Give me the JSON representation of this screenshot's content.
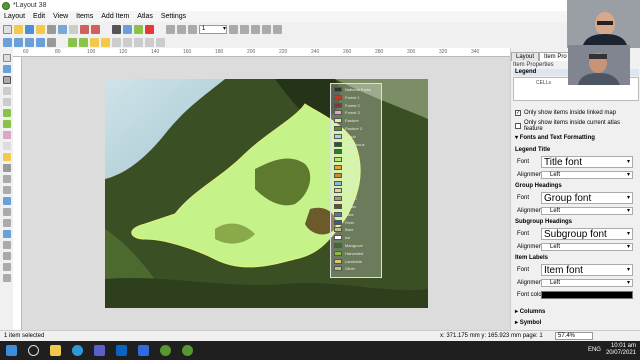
{
  "window": {
    "title": "*Layout 38"
  },
  "menu": [
    "Layout",
    "Edit",
    "View",
    "Items",
    "Add Item",
    "Atlas",
    "Settings"
  ],
  "toolbar": {
    "atlas_page": "1"
  },
  "ruler_ticks": [
    "60",
    "80",
    "100",
    "120",
    "140",
    "160",
    "180",
    "200",
    "220",
    "240",
    "260",
    "280",
    "300",
    "320",
    "340"
  ],
  "legend_entries": [
    {
      "label": "National Parks",
      "color": "#333333"
    },
    {
      "label": "Forest 1",
      "color": "#c0392b"
    },
    {
      "label": "Forest 2",
      "color": "#7b3b3b"
    },
    {
      "label": "Forest 3",
      "color": "#d9a7c7"
    },
    {
      "label": "Pasture",
      "color": "#e8e8a0"
    },
    {
      "label": "Pasture 2",
      "color": "#5a8a3a"
    },
    {
      "label": "Shrub",
      "color": "#a0d8e8"
    },
    {
      "label": "Indigenous",
      "color": "#1e5d2a"
    },
    {
      "label": "Exotic",
      "color": "#2e7d32"
    },
    {
      "label": "Grass",
      "color": "#c6e07a"
    },
    {
      "label": "Tussock",
      "color": "#e3a23a"
    },
    {
      "label": "Scrub",
      "color": "#c98b3b"
    },
    {
      "label": "Wetland",
      "color": "#8fb3d9"
    },
    {
      "label": "Sand",
      "color": "#e0d3a0"
    },
    {
      "label": "Gravel",
      "color": "#a0a080"
    },
    {
      "label": "Urban",
      "color": "#6b4e2e"
    },
    {
      "label": "Lake",
      "color": "#4a7aa8"
    },
    {
      "label": "River",
      "color": "#2e5e8a"
    },
    {
      "label": "Bare",
      "color": "#c9b88a"
    },
    {
      "label": "Ice",
      "color": "#ffffff"
    },
    {
      "label": "Mangrove",
      "color": "#3b6e3b"
    },
    {
      "label": "Harvested",
      "color": "#8db84a"
    },
    {
      "label": "Landslide",
      "color": "#d9c27a"
    },
    {
      "label": "Other",
      "color": "#b0d070"
    }
  ],
  "panel": {
    "tabs": [
      "Layout",
      "Item Pro"
    ],
    "header": "Item Properties",
    "section_legend": "Legend",
    "list_item": "CELLs",
    "chk_linked_map": "Only show items inside linked map",
    "chk_atlas": "Only show items inside current atlas feature",
    "section_fonts": "Fonts and Text Formatting",
    "legend_title": "Legend Title",
    "group_headings": "Group Headings",
    "subgroup_headings": "Subgroup Headings",
    "item_labels": "Item Labels",
    "font_label": "Font",
    "alignment_label": "Alignment",
    "font_color_label": "Font color",
    "title_font": "Title font",
    "group_font": "Group font",
    "subgroup_font": "Subgroup font",
    "item_font": "Item font",
    "align_value": "Left",
    "section_columns": "Columns",
    "section_symbol": "Symbol"
  },
  "status": {
    "left": "1 item selected",
    "coords": "x: 371.175 mm  y: 165.923 mm  page: 1",
    "zoom": "57.4%"
  },
  "taskbar": {
    "lang": "ENG",
    "time": "10:01 am",
    "date": "20/07/2021"
  },
  "colors": {
    "accent": "#589632",
    "selection": "#000000",
    "mapdark": "#2c3b1d",
    "mapgreen": "#c6f28a"
  }
}
